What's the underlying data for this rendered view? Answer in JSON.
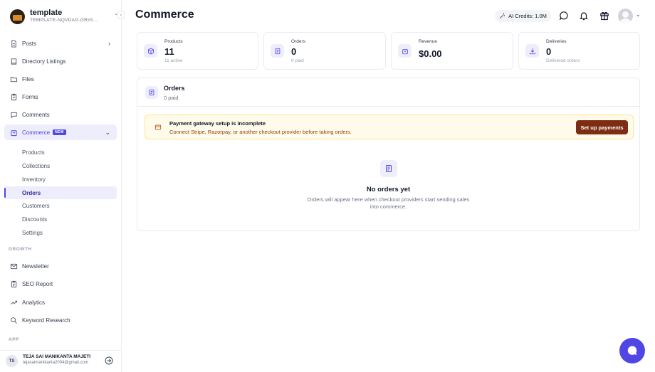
{
  "workspace": {
    "name": "template",
    "subtitle": "TEMPLATE-NQVDAG.GRIGOR..."
  },
  "sidebar": {
    "items": [
      {
        "label": "Posts"
      },
      {
        "label": "Directory Listings"
      },
      {
        "label": "Files"
      },
      {
        "label": "Forms"
      },
      {
        "label": "Comments"
      },
      {
        "label": "Commerce",
        "badge": "NEW"
      }
    ],
    "commerce_sub": [
      {
        "label": "Products"
      },
      {
        "label": "Collections"
      },
      {
        "label": "Inventory"
      },
      {
        "label": "Orders"
      },
      {
        "label": "Customers"
      },
      {
        "label": "Discounts"
      },
      {
        "label": "Settings"
      }
    ],
    "growth_label": "GROWTH",
    "growth_items": [
      {
        "label": "Newsletter"
      },
      {
        "label": "SEO Report"
      },
      {
        "label": "Analytics"
      },
      {
        "label": "Keyword Research"
      }
    ],
    "app_label": "APP"
  },
  "user": {
    "initials": "TS",
    "name": "TEJA SAI MANIKANTA MAJETI",
    "email": "tejasaimanikanta2004@gmail.com"
  },
  "header": {
    "title": "Commerce",
    "credits": "AI Credits: 1.0M"
  },
  "stats": [
    {
      "label": "Products",
      "value": "11",
      "sub": "11 active"
    },
    {
      "label": "Orders",
      "value": "0",
      "sub": "0 paid"
    },
    {
      "label": "Revenue",
      "value": "$0.00",
      "sub": ""
    },
    {
      "label": "Deliveries",
      "value": "0",
      "sub": "Delivered orders"
    }
  ],
  "orders_panel": {
    "title": "Orders",
    "subtitle": "0 paid",
    "alert": {
      "title": "Payment gateway setup is incomplete",
      "description": "Connect Stripe, Razorpay, or another checkout provider before taking orders.",
      "button": "Set up payments"
    },
    "empty": {
      "title": "No orders yet",
      "description": "Orders will appear here when checkout providers start sending sales into commerce."
    }
  },
  "colors": {
    "accent": "#4f46e5",
    "accent_soft": "#eeedfb",
    "alert_bg": "#fffbeb",
    "alert_button": "#7c2d12"
  }
}
